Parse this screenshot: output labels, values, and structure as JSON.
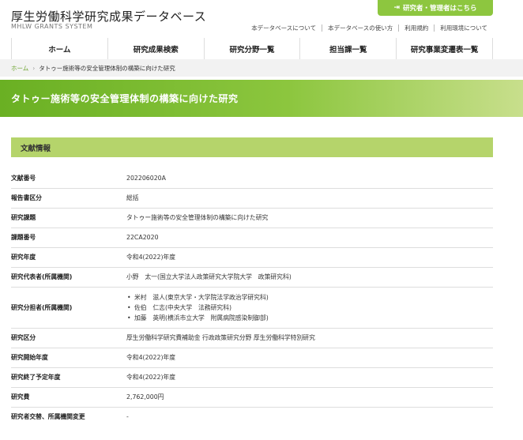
{
  "header": {
    "site_title": "厚生労働科学研究成果データベース",
    "site_subtitle": "MHLW GRANTS SYSTEM",
    "login_label": "研究者・管理者はこちら",
    "util_links": [
      "本データベースについて",
      "本データベースの使い方",
      "利用規約",
      "利用環境について"
    ]
  },
  "nav": [
    "ホーム",
    "研究成果検索",
    "研究分野一覧",
    "担当課一覧",
    "研究事業変遷表一覧"
  ],
  "breadcrumb": {
    "home": "ホーム",
    "separator": "›",
    "current": "タトゥー施術等の安全管理体制の構築に向けた研究"
  },
  "page_title": "タトゥー施術等の安全管理体制の構築に向けた研究",
  "section_title": "文献情報",
  "rows": [
    {
      "label": "文献番号",
      "value": "202206020A"
    },
    {
      "label": "報告書区分",
      "value": "総括"
    },
    {
      "label": "研究課題",
      "value": "タトゥー施術等の安全管理体制の構築に向けた研究"
    },
    {
      "label": "課題番号",
      "value": "22CA2020"
    },
    {
      "label": "研究年度",
      "value": "令和4(2022)年度"
    },
    {
      "label": "研究代表者(所属機関)",
      "value": "小野　太一(国立大学法人政策研究大学院大学　政策研究科)"
    },
    {
      "label": "研究分担者(所属機関)",
      "items": [
        "米村　滋人(東京大学・大学院法学政治学研究科)",
        "佐伯　仁志(中央大学　法務研究科)",
        "加藤　英明(横浜市立大学　附属病院感染制御部)"
      ]
    },
    {
      "label": "研究区分",
      "value": "厚生労働科学研究費補助金 行政政策研究分野 厚生労働科学特別研究"
    },
    {
      "label": "研究開始年度",
      "value": "令和4(2022)年度"
    },
    {
      "label": "研究終了予定年度",
      "value": "令和4(2022)年度"
    },
    {
      "label": "研究費",
      "value": "2,762,000円"
    },
    {
      "label": "研究者交替、所属機関変更",
      "value": "-"
    }
  ],
  "colors": {
    "accent": "#8dc63f",
    "section_bg": "#b5d46b"
  }
}
